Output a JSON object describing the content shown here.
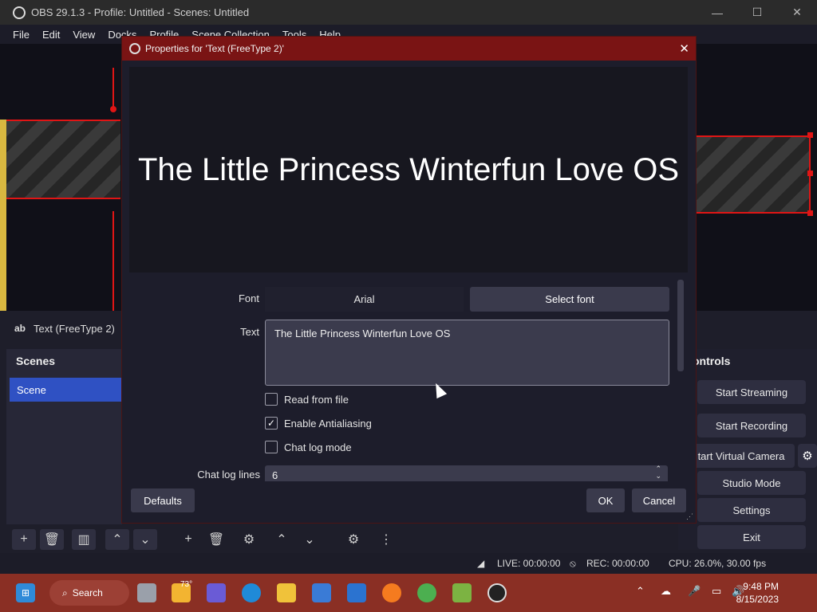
{
  "window": {
    "title": "OBS 29.1.3 - Profile: Untitled - Scenes: Untitled",
    "min": "—",
    "max": "☐",
    "close": "✕"
  },
  "menu": [
    "File",
    "Edit",
    "View",
    "Docks",
    "Profile",
    "Scene Collection",
    "Tools",
    "Help"
  ],
  "source_label": {
    "icon": "ab",
    "name": "Text (FreeType 2)"
  },
  "scenes": {
    "header": "Scenes",
    "items": [
      "Scene"
    ]
  },
  "controls": {
    "header": "ontrols",
    "start_streaming": "Start Streaming",
    "start_recording": "Start Recording",
    "virtual_camera": "tart Virtual Camera",
    "studio_mode": "Studio Mode",
    "settings": "Settings",
    "exit": "Exit"
  },
  "dialog": {
    "title": "Properties for 'Text (FreeType 2)'",
    "preview_text": "The Little Princess Winterfun Love OS",
    "font_label": "Font",
    "font_value": "Arial",
    "select_font": "Select font",
    "text_label": "Text",
    "text_value": "The Little Princess Winterfun Love OS",
    "read_from_file": {
      "label": "Read from file",
      "checked": false
    },
    "antialiasing": {
      "label": "Enable Antialiasing",
      "checked": true
    },
    "chat_log_mode": {
      "label": "Chat log mode",
      "checked": false
    },
    "chat_log_lines_label": "Chat log lines",
    "chat_log_lines_value": "6",
    "defaults": "Defaults",
    "ok": "OK",
    "cancel": "Cancel"
  },
  "status": {
    "live": "LIVE: 00:00:00",
    "rec": "REC: 00:00:00",
    "cpu": "CPU: 26.0%, 30.00 fps"
  },
  "taskbar": {
    "search": "Search",
    "weather": "73°",
    "time": "9:48 PM",
    "date": "8/15/2023"
  },
  "colors": {
    "dialog_title": "#7a1414",
    "scene_selected": "#2f51c3",
    "taskbar": "#8a2f24",
    "selection": "#e01515"
  }
}
